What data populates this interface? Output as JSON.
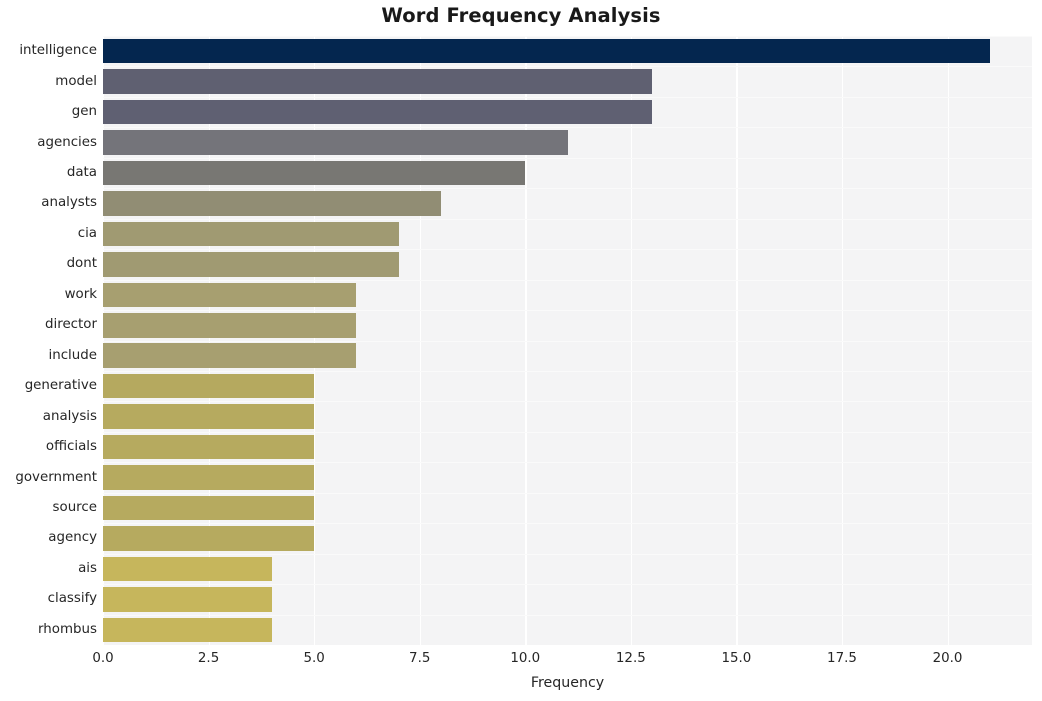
{
  "chart_data": {
    "type": "bar",
    "orientation": "horizontal",
    "title": "Word Frequency Analysis",
    "xlabel": "Frequency",
    "ylabel": "",
    "xlim": [
      0,
      22
    ],
    "ylim": [
      0,
      20
    ],
    "grid": true,
    "legend": null,
    "xticks": [
      "0.0",
      "2.5",
      "5.0",
      "7.5",
      "10.0",
      "12.5",
      "15.0",
      "17.5",
      "20.0"
    ],
    "xtick_values": [
      0,
      2.5,
      5,
      7.5,
      10,
      12.5,
      15,
      17.5,
      20
    ],
    "categories": [
      "intelligence",
      "model",
      "gen",
      "agencies",
      "data",
      "analysts",
      "cia",
      "dont",
      "work",
      "director",
      "include",
      "generative",
      "analysis",
      "officials",
      "government",
      "source",
      "agency",
      "ais",
      "classify",
      "rhombus"
    ],
    "values": [
      21,
      13,
      13,
      11,
      10,
      8,
      7,
      7,
      6,
      6,
      6,
      5,
      5,
      5,
      5,
      5,
      5,
      4,
      4,
      4
    ],
    "bar_colors": [
      "#04264f",
      "#5f6071",
      "#5f6072",
      "#74747a",
      "#787773",
      "#918d74",
      "#a09a72",
      "#a09a72",
      "#a79f70",
      "#a79f70",
      "#a79f70",
      "#b5a95f",
      "#b6aa5f",
      "#b6aa5f",
      "#b6aa5f",
      "#b6aa5f",
      "#b6aa5f",
      "#c6b65c",
      "#c6b65c",
      "#c6b65c"
    ],
    "plot_background": "#f4f4f5",
    "gridline_color": "#ffffff",
    "figure_background": "#ffffff",
    "text_color": "#262626",
    "title_color": "#191919"
  }
}
